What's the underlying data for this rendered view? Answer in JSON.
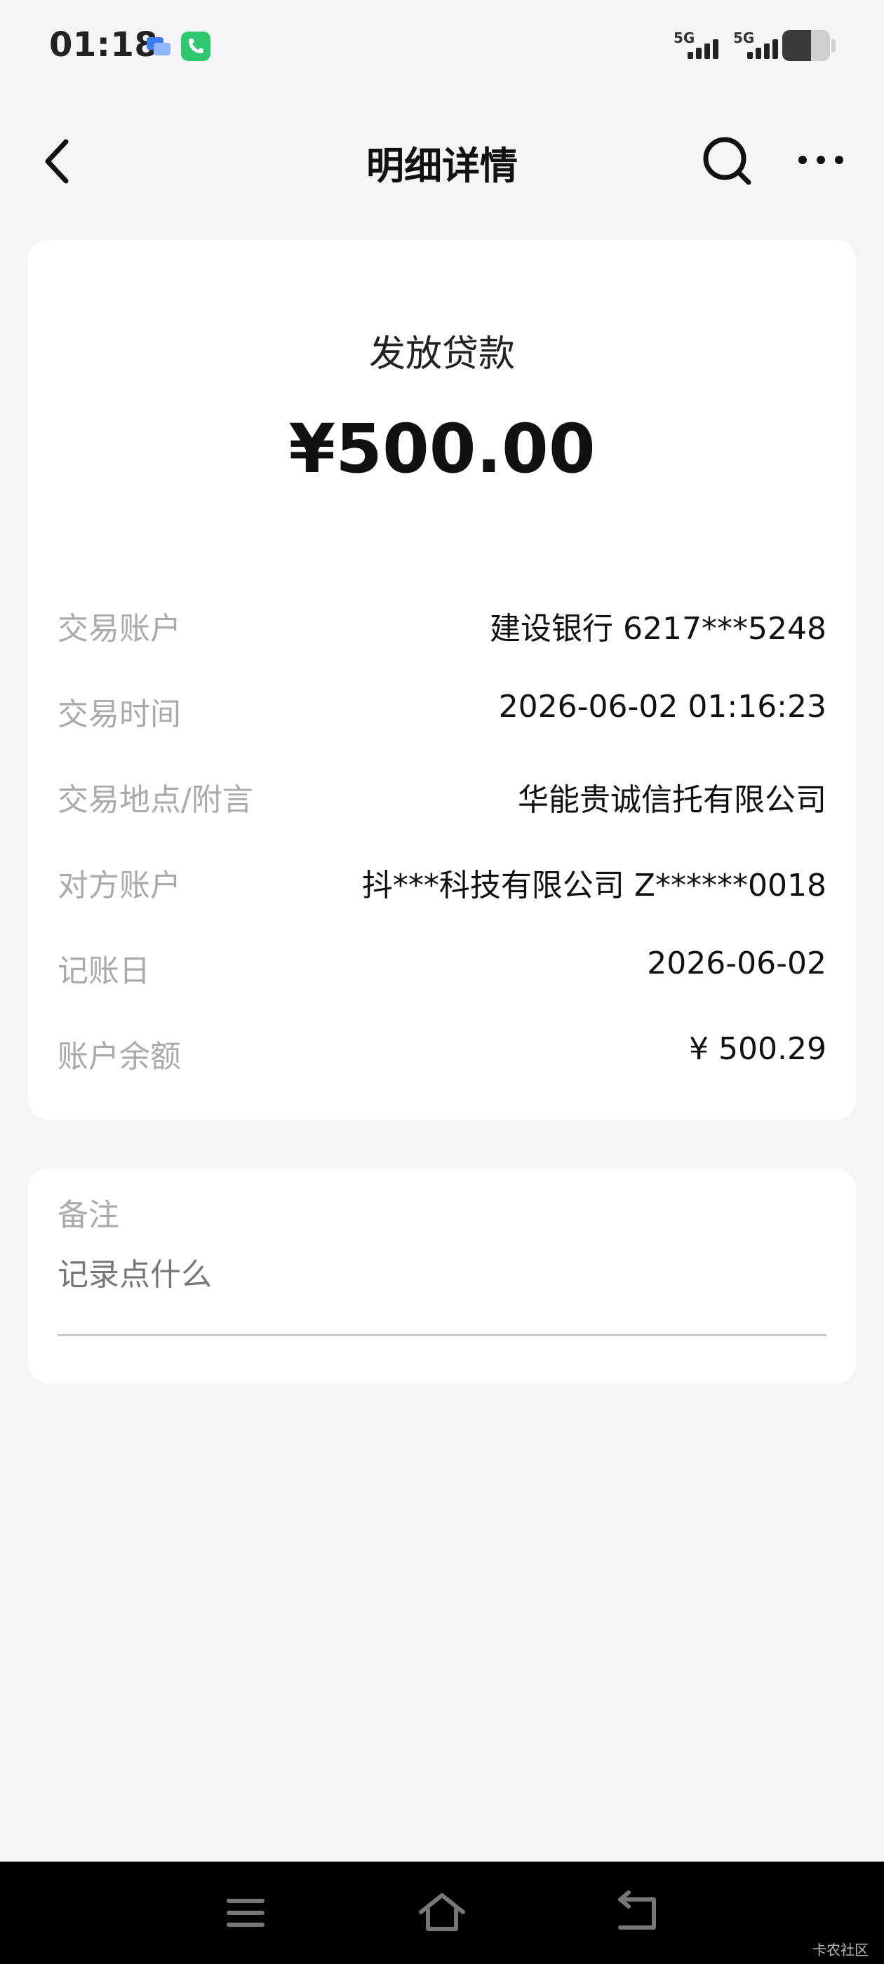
{
  "status_bar": {
    "time": "01:18",
    "network_1": "5G",
    "network_2": "5G",
    "battery_level": 0.6,
    "icons": [
      "message-app-icon",
      "phone-call-icon",
      "signal-icon",
      "battery-icon"
    ]
  },
  "header": {
    "title": "明细详情",
    "icons": [
      "back-arrow-icon",
      "search-icon",
      "more-dots-icon"
    ]
  },
  "transaction": {
    "type": "发放贷款",
    "amount": "¥500.00",
    "details": [
      {
        "label": "交易账户",
        "value": "建设银行 6217***5248"
      },
      {
        "label": "交易时间",
        "value": "2026-06-02 01:16:23"
      },
      {
        "label": "交易地点/附言",
        "value": "华能贵诚信托有限公司"
      },
      {
        "label": "对方账户",
        "value": "抖***科技有限公司 Z******0018"
      },
      {
        "label": "记账日",
        "value": "2026-06-02"
      },
      {
        "label": "账户余额",
        "value": "¥ 500.29"
      }
    ]
  },
  "notes": {
    "label": "备注",
    "placeholder": "记录点什么",
    "value": ""
  },
  "system_nav": {
    "icons": [
      "menu-icon",
      "home-icon",
      "return-icon"
    ],
    "watermark": "卡农社区"
  },
  "colors": {
    "background": "#f5f5f7",
    "card": "#ffffff",
    "label_text": "#aaaaaa",
    "value_text": "#111111",
    "nav_background": "#000000",
    "phone_icon": "#2fc86e",
    "message_icon": "#3b7cf0"
  }
}
